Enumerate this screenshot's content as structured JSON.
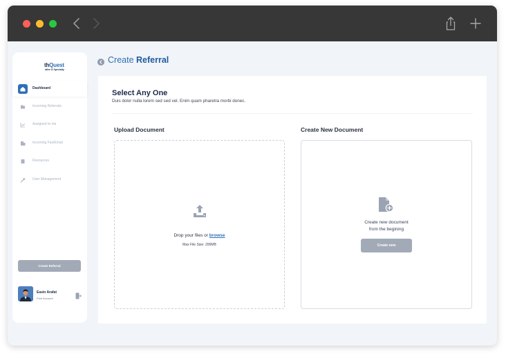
{
  "sidebar": {
    "logo": {
      "main_a": "th",
      "main_b": "Quest",
      "sub": "ative & Specialty"
    },
    "items": [
      {
        "label": "Dashboard",
        "icon": "home-icon",
        "active": true
      },
      {
        "label": "Incoming Referrals",
        "icon": "folder-icon",
        "active": false
      },
      {
        "label": "Assigned to me",
        "icon": "chart-icon",
        "active": false
      },
      {
        "label": "Incoming Fax/Email",
        "icon": "fax-icon",
        "active": false
      },
      {
        "label": "Resources",
        "icon": "book-icon",
        "active": false
      },
      {
        "label": "User Management",
        "icon": "wrench-icon",
        "active": false
      }
    ],
    "create_button": "Create Referral",
    "user": {
      "name": "Easin Arafat",
      "plan": "Free Account"
    }
  },
  "page": {
    "title_prefix": "Create",
    "title_bold": "Referral"
  },
  "card": {
    "title": "Select Any One",
    "subtitle": "Duis dolor nulla lorem sed sed vel. Enim quam pharetra morbi donec.",
    "upload": {
      "title": "Upload Document",
      "drop_text": "Drop your files or",
      "browse_link": "browse",
      "max_size": "Max File Size: 200MB"
    },
    "create": {
      "title": "Create New Document",
      "line1": "Create new document",
      "line2": "from the begining",
      "button": "Create new"
    }
  },
  "colors": {
    "accent": "#2f6fb7",
    "titlebar": "#373737",
    "background": "#f1f4f8",
    "button_gray": "#a2aab8"
  }
}
